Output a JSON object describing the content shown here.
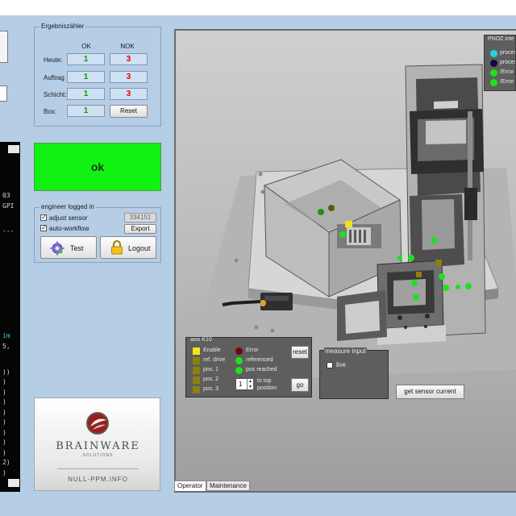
{
  "console": {
    "lines": [
      {
        "text": "03",
        "color": "#d8d8d8"
      },
      {
        "text": "GPI",
        "color": "#d8d8d8"
      },
      {
        "text": "---",
        "color": "#d8d8d8"
      },
      {
        "text": "im",
        "color": "#40c8e8"
      },
      {
        "text": "5,",
        "color": "#d8d8d8"
      },
      {
        "text": "))",
        "color": "#d8d8d8"
      },
      {
        "text": ")",
        "color": "#d8d8d8"
      },
      {
        "text": ")",
        "color": "#d8d8d8"
      },
      {
        "text": ")",
        "color": "#d8d8d8"
      },
      {
        "text": ")",
        "color": "#d8d8d8"
      },
      {
        "text": ")",
        "color": "#d8d8d8"
      },
      {
        "text": ")",
        "color": "#d8d8d8"
      },
      {
        "text": ")",
        "color": "#d8d8d8"
      },
      {
        "text": ")",
        "color": "#d8d8d8"
      },
      {
        "text": "2)",
        "color": "#d8d8d8"
      },
      {
        "text": ")",
        "color": "#d8d8d8"
      }
    ]
  },
  "counter": {
    "title": "Ergebniszähler",
    "col_ok": "OK",
    "col_nok": "NOK",
    "rows": [
      {
        "label": "Heute:",
        "ok": "1",
        "nok": "3"
      },
      {
        "label": "Auftrag",
        "ok": "1",
        "nok": "3"
      },
      {
        "label": "Schicht:",
        "ok": "1",
        "nok": "3"
      },
      {
        "label": "Box:",
        "ok": "1"
      }
    ],
    "reset_label": "Reset"
  },
  "status": {
    "text": "ok",
    "color": "#12f212"
  },
  "engineer": {
    "title": "engineer logged in",
    "adjust_sensor": {
      "label": "adjust sensor",
      "checked": true
    },
    "auto_workflow": {
      "label": "auto-workflow",
      "checked": true
    },
    "id_value": "334151",
    "export_label": "Export",
    "test_label": "Test",
    "logout_label": "Logout"
  },
  "logo": {
    "brand": "BRAINWARE",
    "sub": "SOLUTIONS",
    "url": "NULL-PPM.INFO"
  },
  "legend": {
    "title": "PNOZ inte",
    "items": [
      {
        "label": "proces",
        "color": "#22d3e0"
      },
      {
        "label": "proces",
        "color": "#0c0c3a"
      },
      {
        "label": "/Error",
        "color": "#1fe01f"
      },
      {
        "label": "/Error",
        "color": "#1fe01f"
      }
    ]
  },
  "axis": {
    "title": "axis K10",
    "enable": {
      "label": "Enable",
      "color": "#f4e21a"
    },
    "ref_drive": {
      "label": "ref. drive",
      "color": "#8c8010"
    },
    "pos1": {
      "label": "pos. 1",
      "color": "#8c8010"
    },
    "pos2": {
      "label": "pos. 2",
      "color": "#8c8010"
    },
    "pos3": {
      "label": "pos. 3",
      "color": "#8c8010"
    },
    "error": {
      "label": "Error",
      "color": "#6e0a0a"
    },
    "referenced": {
      "label": "referenced",
      "color": "#1fe01f"
    },
    "pos_reached": {
      "label": "pos reached",
      "color": "#1fe01f"
    },
    "reset_label": "reset",
    "stepper_value": "1",
    "to_top_label": "to top",
    "position_label": "position",
    "go_label": "go"
  },
  "measure": {
    "title": "measure input",
    "live_label": "live",
    "live_checked": false
  },
  "get_sensor_label": "get sensor current",
  "tabs": [
    {
      "label": "Operator",
      "active": true
    },
    {
      "label": "Maintenance",
      "active": false
    }
  ]
}
